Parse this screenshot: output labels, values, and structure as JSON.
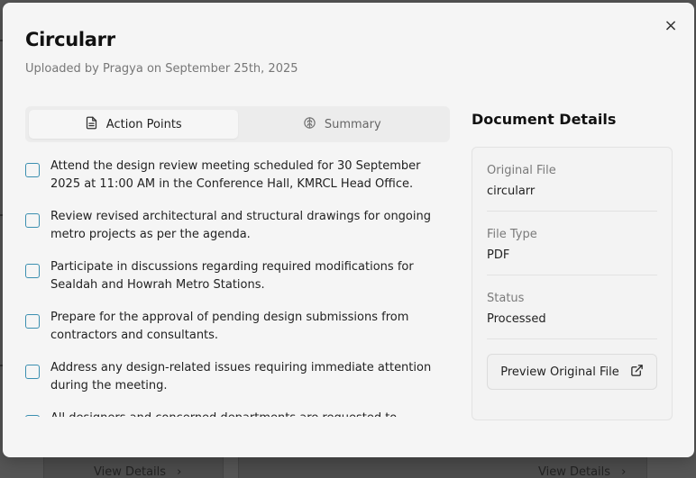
{
  "background": {
    "links": [
      "View Details",
      "View Details"
    ]
  },
  "modal": {
    "close_glyph": "×",
    "title": "Circularr",
    "subtitle": "Uploaded by Pragya on September 25th, 2025",
    "tabs": [
      {
        "label": "Action Points",
        "icon": "file-text-icon",
        "active": true
      },
      {
        "label": "Summary",
        "icon": "brain-icon",
        "active": false
      }
    ],
    "action_points": [
      "Attend the design review meeting scheduled for 30 September 2025 at 11:00 AM in the Conference Hall, KMRCL Head Office.",
      "Review revised architectural and structural drawings for ongoing metro projects as per the agenda.",
      "Participate in discussions regarding required modifications for Sealdah and Howrah Metro Stations.",
      "Prepare for the approval of pending design submissions from contractors and consultants.",
      "Address any design-related issues requiring immediate attention during the meeting.",
      "All designers and concerned departments are requested to ensure attendance."
    ],
    "details": {
      "title": "Document Details",
      "rows": [
        {
          "label": "Original File",
          "value": "circularr"
        },
        {
          "label": "File Type",
          "value": "PDF"
        },
        {
          "label": "Status",
          "value": "Processed"
        }
      ],
      "preview_label": "Preview Original File"
    }
  },
  "colors": {
    "accent_checkbox": "#3b8fb0",
    "modal_bg": "#f5f5f5",
    "overlay": "#555555"
  }
}
